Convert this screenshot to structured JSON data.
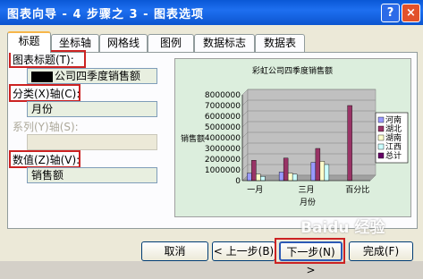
{
  "window": {
    "title": "图表向导 - 4 步骤之 3 - 图表选项",
    "help_btn": "?",
    "close_btn": "×"
  },
  "tabs": [
    "标题",
    "坐标轴",
    "网格线",
    "图例",
    "数据标志",
    "数据表"
  ],
  "form": {
    "chart_title_label": "图表标题(T):",
    "chart_title_value": "公司四季度销售额",
    "x_axis_label": "分类(X)轴(C):",
    "x_axis_value": "月份",
    "series_axis_label": "系列(Y)轴(S):",
    "series_axis_value": "",
    "y_axis_label": "数值(Z)轴(V):",
    "y_axis_value": "销售额"
  },
  "chart_data": {
    "type": "bar",
    "title": "彩虹公司四季度销售额",
    "xlabel": "月份",
    "ylabel": "销售额",
    "ylim": [
      0,
      8000000
    ],
    "yticks": [
      "0",
      "1000000",
      "2000000",
      "3000000",
      "4000000",
      "5000000",
      "6000000",
      "7000000",
      "8000000"
    ],
    "categories": [
      "一月",
      "三月",
      "百分比"
    ],
    "category_positions": [
      "一月",
      "",
      "三月",
      "",
      "百分比"
    ],
    "series": [
      {
        "name": "河南",
        "color": "#9999ff",
        "values": [
          700000,
          800000,
          1700000,
          0
        ]
      },
      {
        "name": "湖北",
        "color": "#993366",
        "values": [
          1900000,
          2100000,
          3000000,
          7000000
        ]
      },
      {
        "name": "湖南",
        "color": "#ffffcc",
        "values": [
          600000,
          700000,
          1800000,
          0
        ]
      },
      {
        "name": "江西",
        "color": "#ccffff",
        "values": [
          400000,
          600000,
          1500000,
          0
        ]
      },
      {
        "name": "总计",
        "color": "#660066",
        "values": [
          0,
          0,
          0,
          0
        ]
      }
    ]
  },
  "watermark": "Baidu 经验",
  "buttons": {
    "cancel": "取消",
    "back": "< 上一步(B)",
    "next": "下一步(N) >",
    "finish": "完成(F)"
  }
}
